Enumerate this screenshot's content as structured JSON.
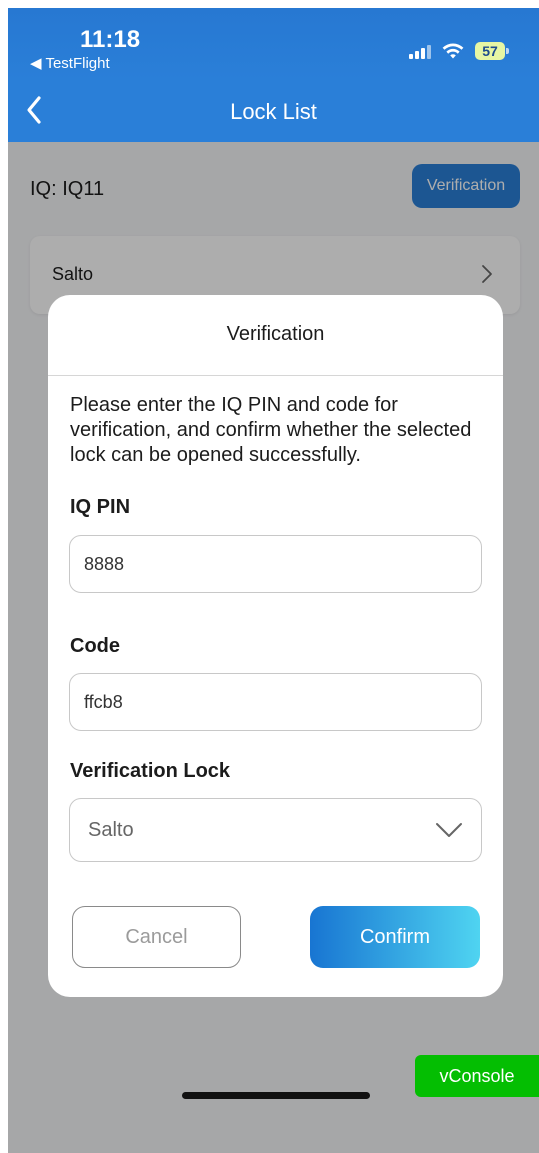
{
  "status_bar": {
    "time": "11:18",
    "back_app": "TestFlight",
    "battery": "57",
    "signal_icon": "signal-icon",
    "wifi_icon": "wifi-icon"
  },
  "nav": {
    "title": "Lock List",
    "back_icon": "chevron-left-icon"
  },
  "page": {
    "iq_label": "IQ: IQ11",
    "verification_button": "Verification",
    "lock_list": [
      {
        "label": "Salto"
      }
    ]
  },
  "modal": {
    "title": "Verification",
    "description": "Please enter the IQ PIN and code for verification, and confirm whether the selected lock can be opened successfully.",
    "pin": {
      "label": "IQ PIN",
      "value": "8888"
    },
    "code": {
      "label": "Code",
      "value": "ffcb8"
    },
    "lock": {
      "label": "Verification Lock",
      "value": "Salto"
    },
    "cancel_label": "Cancel",
    "confirm_label": "Confirm"
  },
  "vconsole": {
    "label": "vConsole"
  },
  "colors": {
    "primary": "#2a7fd8",
    "confirm_gradient_start": "#1875d2",
    "confirm_gradient_end": "#4fd4f1",
    "vconsole": "#04be02"
  }
}
